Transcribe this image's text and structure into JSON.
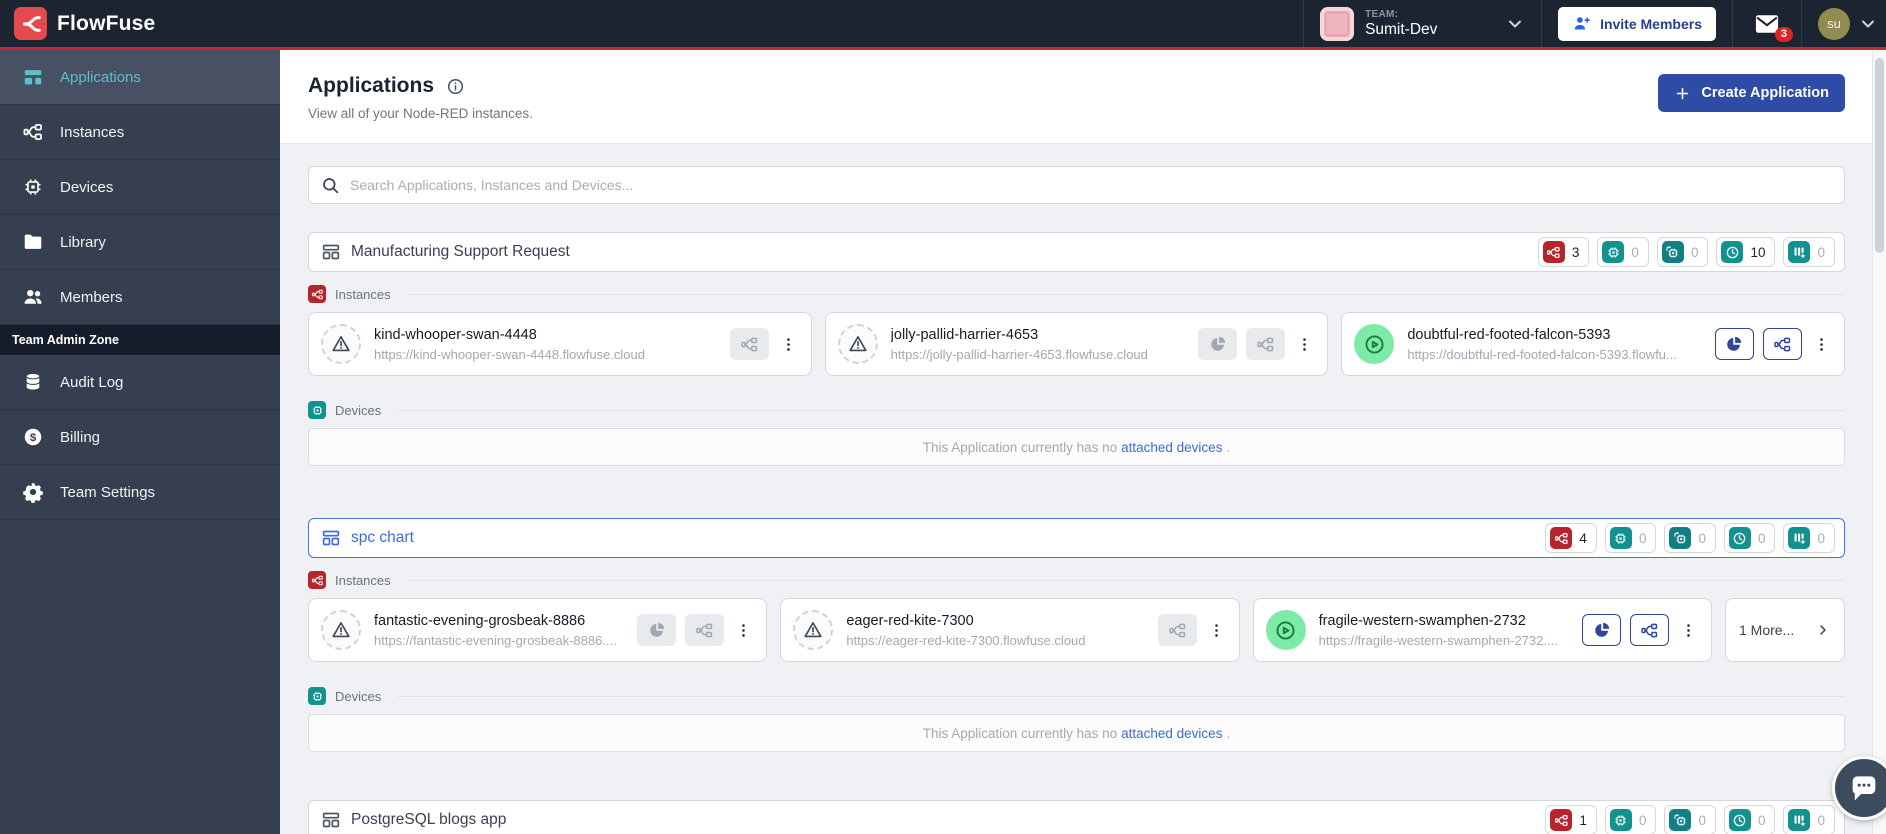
{
  "topnav": {
    "brand": "FlowFuse",
    "team_label": "TEAM:",
    "team_name": "Sumit-Dev",
    "invite_button_label": "Invite Members",
    "notification_badge": "3",
    "avatar_initials": "su"
  },
  "sidebar": {
    "items": [
      {
        "label": "Applications"
      },
      {
        "label": "Instances"
      },
      {
        "label": "Devices"
      },
      {
        "label": "Library"
      },
      {
        "label": "Members"
      }
    ],
    "admin_zone_label": "Team Admin Zone",
    "admin_items": [
      {
        "label": "Audit Log"
      },
      {
        "label": "Billing"
      },
      {
        "label": "Team Settings"
      }
    ]
  },
  "page": {
    "title": "Applications",
    "subtitle": "View all of your Node-RED instances.",
    "create_button_label": "Create Application"
  },
  "search": {
    "placeholder": "Search Applications, Instances and Devices..."
  },
  "labels": {
    "instances": "Instances",
    "devices": "Devices",
    "no_devices_prefix": "This Application currently has no",
    "no_devices_link": "attached devices",
    "no_devices_suffix": "."
  },
  "apps": [
    {
      "name": "Manufacturing Support Request",
      "badges": [
        {
          "count": "3"
        },
        {
          "count": "0"
        },
        {
          "count": "0"
        },
        {
          "count": "10"
        },
        {
          "count": "0"
        }
      ],
      "instances": [
        {
          "name": "kind-whooper-swan-4448",
          "url": "https://kind-whooper-swan-4448.flowfuse.cloud",
          "state": "suspended"
        },
        {
          "name": "jolly-pallid-harrier-4653",
          "url": "https://jolly-pallid-harrier-4653.flowfuse.cloud",
          "state": "suspended"
        },
        {
          "name": "doubtful-red-footed-falcon-5393",
          "url": "https://doubtful-red-footed-falcon-5393.flowfu...",
          "state": "running"
        }
      ]
    },
    {
      "name": "spc chart",
      "badges": [
        {
          "count": "4"
        },
        {
          "count": "0"
        },
        {
          "count": "0"
        },
        {
          "count": "0"
        },
        {
          "count": "0"
        }
      ],
      "instances": [
        {
          "name": "fantastic-evening-grosbeak-8886",
          "url": "https://fantastic-evening-grosbeak-8886....",
          "state": "suspended"
        },
        {
          "name": "eager-red-kite-7300",
          "url": "https://eager-red-kite-7300.flowfuse.cloud",
          "state": "suspended"
        },
        {
          "name": "fragile-western-swamphen-2732",
          "url": "https://fragile-western-swamphen-2732....",
          "state": "running"
        }
      ],
      "more_label": "1 More..."
    },
    {
      "name": "PostgreSQL blogs app",
      "badges": [
        {
          "count": "1"
        },
        {
          "count": "0"
        },
        {
          "count": "0"
        },
        {
          "count": "0"
        },
        {
          "count": "0"
        }
      ]
    }
  ],
  "colors": {
    "brand_red": "#e4494e",
    "navbar_bg": "#1c2432",
    "accent_teal": "#5bc0ca",
    "badge_red": "#b6242c",
    "badge_teal": "#12918e",
    "primary_blue": "#2e4ca6",
    "selected_blue": "#4271ef",
    "running_green": "#7fe9a8",
    "link_blue": "#3f6ad8"
  }
}
